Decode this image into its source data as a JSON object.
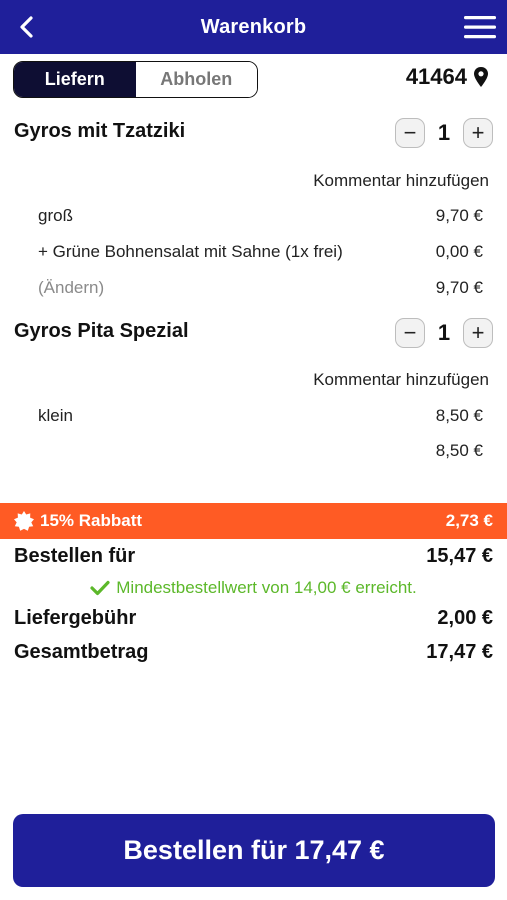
{
  "header": {
    "title": "Warenkorb",
    "back_icon": "chevron-left-icon",
    "menu_icon": "hamburger-menu-icon"
  },
  "delivery_toggle": {
    "options": [
      "Liefern",
      "Abholen"
    ],
    "selected": "Liefern"
  },
  "location": {
    "zip": "41464",
    "icon": "location-pin-icon"
  },
  "cart": {
    "items": [
      {
        "name": "Gyros mit Tzatziki",
        "quantity": "1",
        "comment_label": "Kommentar hinzufügen",
        "lines": [
          {
            "label": "groß",
            "price": "9,70 €"
          },
          {
            "label": "+ Grüne Bohnensalat mit Sahne (1x frei)",
            "price": "0,00 €"
          },
          {
            "label": "(Ändern)",
            "price": "9,70 €"
          }
        ]
      },
      {
        "name": "Gyros Pita Spezial",
        "quantity": "1",
        "comment_label": "Kommentar hinzufügen",
        "lines": [
          {
            "label": "klein",
            "price": "8,50 €"
          },
          {
            "label": "",
            "price": "8,50 €"
          }
        ]
      }
    ],
    "stepper": {
      "minus": "−",
      "plus": "+"
    }
  },
  "discount": {
    "label": "15% Rabbatt",
    "amount": "2,73 €",
    "icon": "badge-icon"
  },
  "summary": {
    "subtotal_label": "Bestellen für",
    "subtotal": "15,47 €",
    "minimum_notice": "Mindestbestellwert von 14,00 € erreicht.",
    "delivery_fee_label": "Liefergebühr",
    "delivery_fee": "2,00 €",
    "total_label": "Gesamtbetrag",
    "total": "17,47 €"
  },
  "order_button": {
    "label": "Bestellen für 17,47 €"
  },
  "colors": {
    "primary": "#1f1f9a",
    "discount": "#ff5b24",
    "success": "#5cb82a",
    "segment_active": "#0e0e33"
  }
}
